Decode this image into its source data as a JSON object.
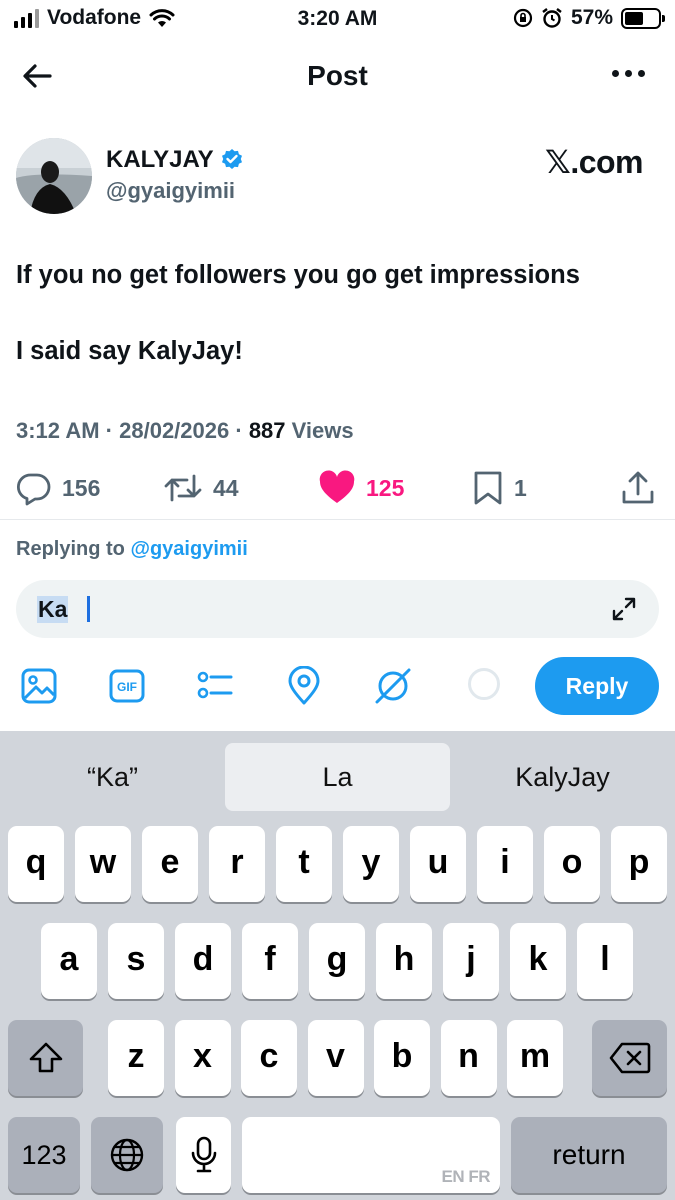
{
  "status_bar": {
    "carrier": "Vodafone",
    "time": "3:20 AM",
    "battery": "57%",
    "battery_level": 0.57
  },
  "header": {
    "title": "Post"
  },
  "author": {
    "name": "KALYJAY",
    "handle": "@gyaigyimii",
    "verified": true,
    "brand": "𝕏.com"
  },
  "post": {
    "lines": [
      "If you no get followers you go get impressions",
      "I said say KalyJay!"
    ],
    "time": "3:12 AM",
    "date": "28/02/2026",
    "views_count": "887",
    "views_label": "Views"
  },
  "actions": {
    "replies": "156",
    "reposts": "44",
    "likes": "125",
    "bookmarks": "1"
  },
  "composer": {
    "replying_prefix": "Replying to",
    "replying_handle": "@gyaigyimii",
    "input_value": "Ka",
    "reply_label": "Reply"
  },
  "keyboard": {
    "suggestions": [
      "“Ka”",
      "La",
      "KalyJay"
    ],
    "row1": [
      "q",
      "w",
      "e",
      "r",
      "t",
      "y",
      "u",
      "i",
      "o",
      "p"
    ],
    "row2": [
      "a",
      "s",
      "d",
      "f",
      "g",
      "h",
      "j",
      "k",
      "l"
    ],
    "row3": [
      "z",
      "x",
      "c",
      "v",
      "b",
      "n",
      "m"
    ],
    "numbers_label": "123",
    "return_label": "return",
    "space_lang": "EN FR"
  },
  "colors": {
    "accent": "#1d9bf0",
    "like": "#f91880",
    "text": "#0f1419",
    "secondary": "#536471"
  }
}
